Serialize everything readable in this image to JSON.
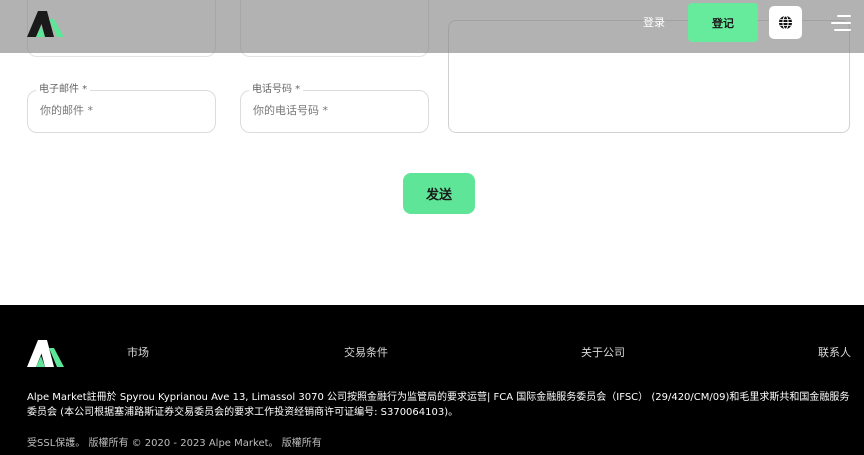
{
  "header": {
    "login_label": "登录",
    "register_label": "登记",
    "icons": {
      "logo": "alpe-logo-icon",
      "language": "globe-icon",
      "menu": "hamburger-menu-icon"
    }
  },
  "form": {
    "email": {
      "label": "电子邮件 *",
      "placeholder": "你的邮件 *"
    },
    "phone": {
      "label": "电话号码 *",
      "placeholder": "你的电话号码 *"
    },
    "send_label": "发送"
  },
  "footer": {
    "nav": [
      "市场",
      "交易条件",
      "关于公司",
      "联系人"
    ],
    "legal_text": "Alpe Market註冊於 Spyrou Kyprianou Ave 13, Limassol 3070 公司按照金融行为监管局的要求运营| FCA 国际金融服务委员会（IFSC） (29/420/CM/09)和毛里求斯共和国金融服务委员会 (本公司根据塞浦路斯证券交易委员会的要求工作投资经销商许可证编号: S370064103)。",
    "copyright": "受SSL保護。 版權所有 © 2020 - 2023 Alpe Market。 版權所有"
  },
  "colors": {
    "accent_green": "#5ee597",
    "footer_bg": "#000000",
    "header_overlay": "#8a8a8a"
  }
}
